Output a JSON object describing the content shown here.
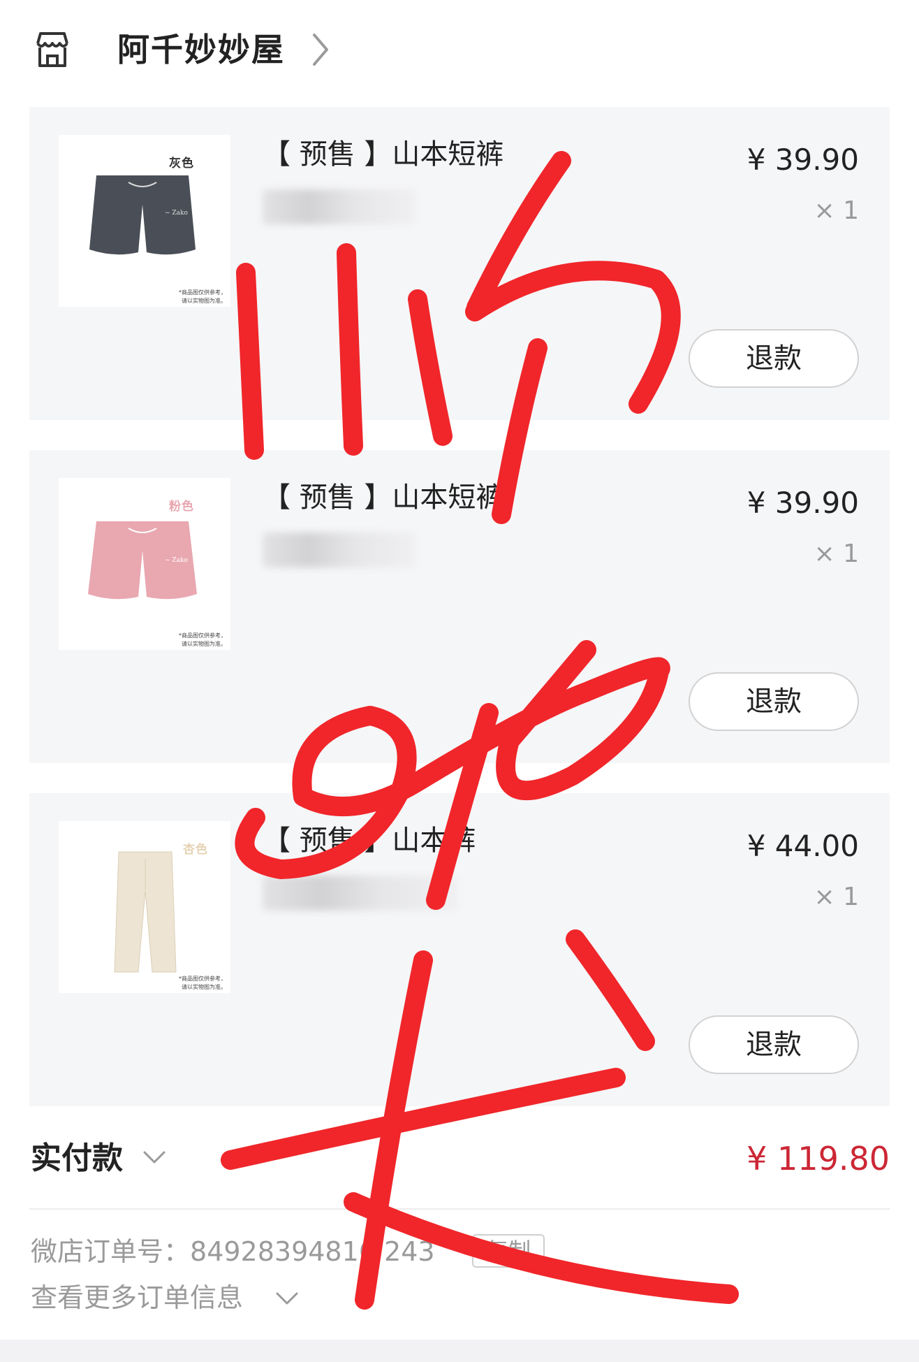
{
  "shop": {
    "name": "阿千妙妙屋"
  },
  "items": [
    {
      "title": "【 预售 】山本短裤",
      "price": "¥ 39.90",
      "qty": "× 1",
      "refund_label": "退款",
      "thumb_color_label": "灰色",
      "thumb_note_1": "*商品图仅供参考，",
      "thumb_note_2": "请以实物图为准。",
      "garment_color": "#4a4f57"
    },
    {
      "title": "【 预售 】山本短裤",
      "price": "¥ 39.90",
      "qty": "× 1",
      "refund_label": "退款",
      "thumb_color_label": "粉色",
      "thumb_note_1": "*商品图仅供参考，",
      "thumb_note_2": "请以实物图为准。",
      "garment_color": "#e9a7b0"
    },
    {
      "title": "【 预售 】山本裤",
      "price": "¥ 44.00",
      "qty": "× 1",
      "refund_label": "退款",
      "thumb_color_label": "杏色",
      "thumb_note_1": "*商品图仅供参考，",
      "thumb_note_2": "请以实物图为准。",
      "garment_color": "#ede4d3"
    }
  ],
  "summary": {
    "paid_label": "实付款",
    "paid_amount": "¥ 119.80"
  },
  "order": {
    "number_label": "微店订单号：",
    "number_value": "84928394816 243",
    "copy_label": "复制",
    "more_info_label": "查看更多订单信息"
  },
  "colors": {
    "accent_price": "#cc2735",
    "card_bg": "#f5f6f8",
    "annotation_ink": "#f0262a"
  },
  "icons": [
    "shop-icon",
    "chevron-right-icon",
    "chevron-down-icon"
  ]
}
